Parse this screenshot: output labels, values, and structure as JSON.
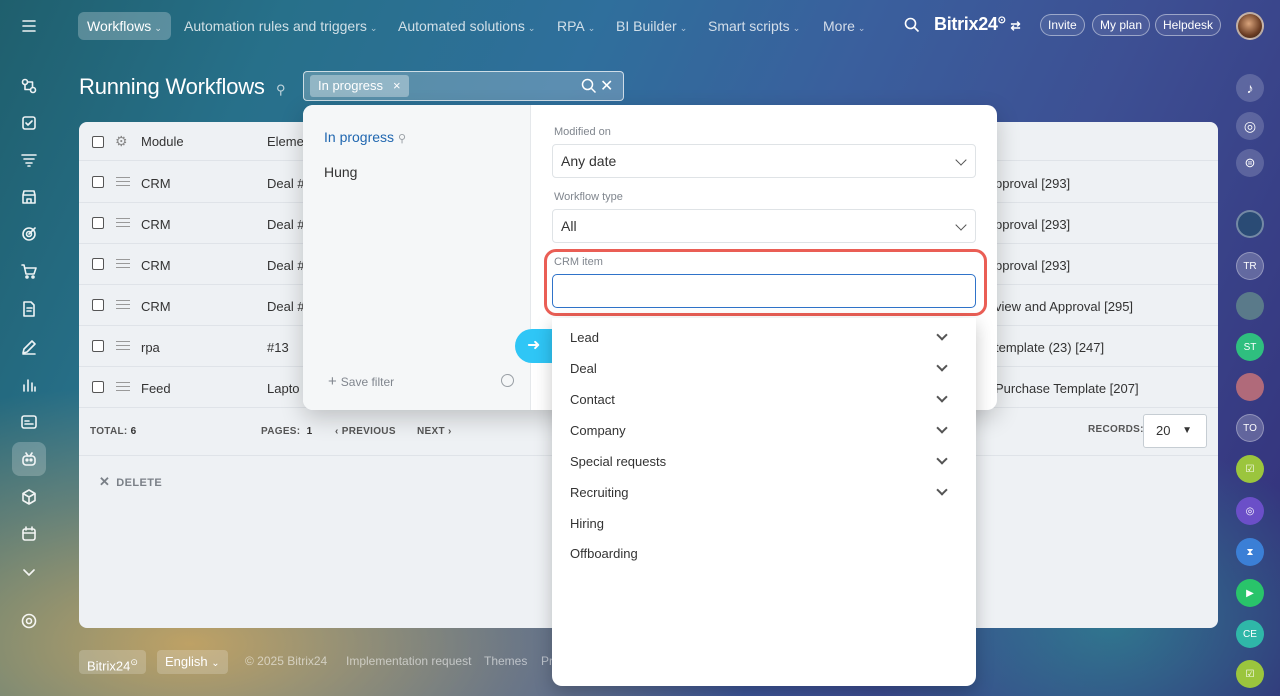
{
  "topbar": {
    "nav": [
      {
        "label": "Workflows"
      },
      {
        "label": "Automation rules and triggers"
      },
      {
        "label": "Automated solutions"
      },
      {
        "label": "RPA"
      },
      {
        "label": "BI Builder"
      },
      {
        "label": "Smart scripts"
      },
      {
        "label": "More"
      }
    ],
    "brand": "Bitrix24",
    "invite": "Invite",
    "plan": "My plan",
    "helpdesk": "Helpdesk"
  },
  "page": {
    "title": "Running Workflows",
    "filter_chip": "In progress"
  },
  "grid": {
    "headers": {
      "module": "Module",
      "element": "Eleme"
    },
    "rows": [
      {
        "module": "CRM",
        "element": "Deal #",
        "workflow": "pproval [293]"
      },
      {
        "module": "CRM",
        "element": "Deal #",
        "workflow": "pproval [293]"
      },
      {
        "module": "CRM",
        "element": "Deal #",
        "workflow": "pproval [293]"
      },
      {
        "module": "CRM",
        "element": "Deal #",
        "workflow": "view and Approval [295]"
      },
      {
        "module": "rpa",
        "element": "#13",
        "workflow": "template (23) [247]"
      },
      {
        "module": "Feed",
        "element": "Lapto",
        "workflow": "Purchase Template [207]"
      }
    ],
    "footer": {
      "total_label": "TOTAL:",
      "total": "6",
      "pages_label": "PAGES:",
      "page": "1",
      "previous": "PREVIOUS",
      "next": "NEXT",
      "records_label": "RECORDS:",
      "records": "20"
    },
    "delete": "DELETE"
  },
  "popup": {
    "presets": [
      "In progress",
      "Hung"
    ],
    "save_filter": "Save filter",
    "modified_label": "Modified on",
    "modified_value": "Any date",
    "type_label": "Workflow type",
    "type_value": "All",
    "crm_label": "CRM item",
    "crm_value": ""
  },
  "dropdown": {
    "items": [
      {
        "label": "Lead",
        "expandable": true
      },
      {
        "label": "Deal",
        "expandable": true
      },
      {
        "label": "Contact",
        "expandable": true
      },
      {
        "label": "Company",
        "expandable": true
      },
      {
        "label": "Special requests",
        "expandable": true
      },
      {
        "label": "Recruiting",
        "expandable": true
      },
      {
        "label": "Hiring",
        "expandable": false
      },
      {
        "label": "Offboarding",
        "expandable": false
      }
    ]
  },
  "rightrail": {
    "initials": [
      "TR",
      "ST",
      "TO",
      "CE"
    ]
  },
  "footer": {
    "brand": "Bitrix24",
    "language": "English",
    "copyright": "© 2025 Bitrix24",
    "impl": "Implementation request",
    "themes": "Themes",
    "pr": "Pr"
  },
  "colors": {
    "accent": "#2fc6f6",
    "highlight": "#ea5e55",
    "link": "#2067b0"
  }
}
